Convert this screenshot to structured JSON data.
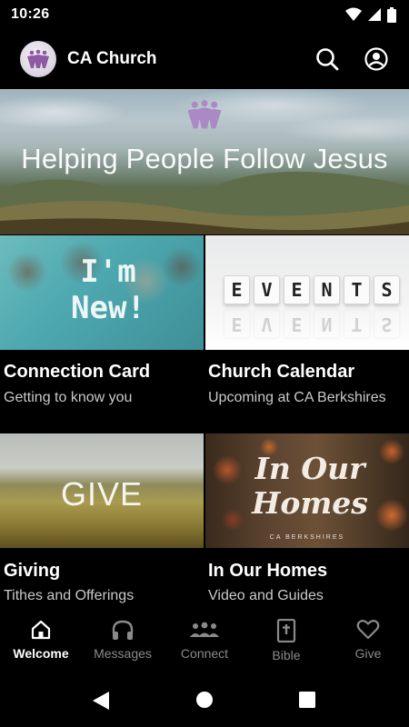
{
  "status_bar": {
    "time": "10:26"
  },
  "app_bar": {
    "title": "CA Church"
  },
  "hero": {
    "caption": "Helping People Follow Jesus"
  },
  "tiles": [
    {
      "image_text": [
        "I'm",
        "New!"
      ],
      "title": "Connection Card",
      "subtitle": "Getting to know you"
    },
    {
      "image_blocks": [
        "E",
        "V",
        "E",
        "N",
        "T",
        "S"
      ],
      "title": "Church Calendar",
      "subtitle": "Upcoming at CA Berkshires"
    },
    {
      "image_text": "GIVE",
      "title": "Giving",
      "subtitle": "Tithes and Offerings"
    },
    {
      "image_text": [
        "In Our",
        "Homes"
      ],
      "image_subtext": "CA BERKSHIRES",
      "title": "In Our Homes",
      "subtitle": "Video and Guides"
    }
  ],
  "bottom_nav": {
    "items": [
      {
        "label": "Welcome",
        "icon": "home-icon",
        "active": true
      },
      {
        "label": "Messages",
        "icon": "headphones-icon",
        "active": false
      },
      {
        "label": "Connect",
        "icon": "people-icon",
        "active": false
      },
      {
        "label": "Bible",
        "icon": "bible-icon",
        "active": false
      },
      {
        "label": "Give",
        "icon": "heart-icon",
        "active": false
      }
    ]
  },
  "colors": {
    "background": "#000000",
    "active_nav": "#ffffff",
    "inactive_nav": "#8a8a8a",
    "subtitle": "#c9c9c9"
  }
}
